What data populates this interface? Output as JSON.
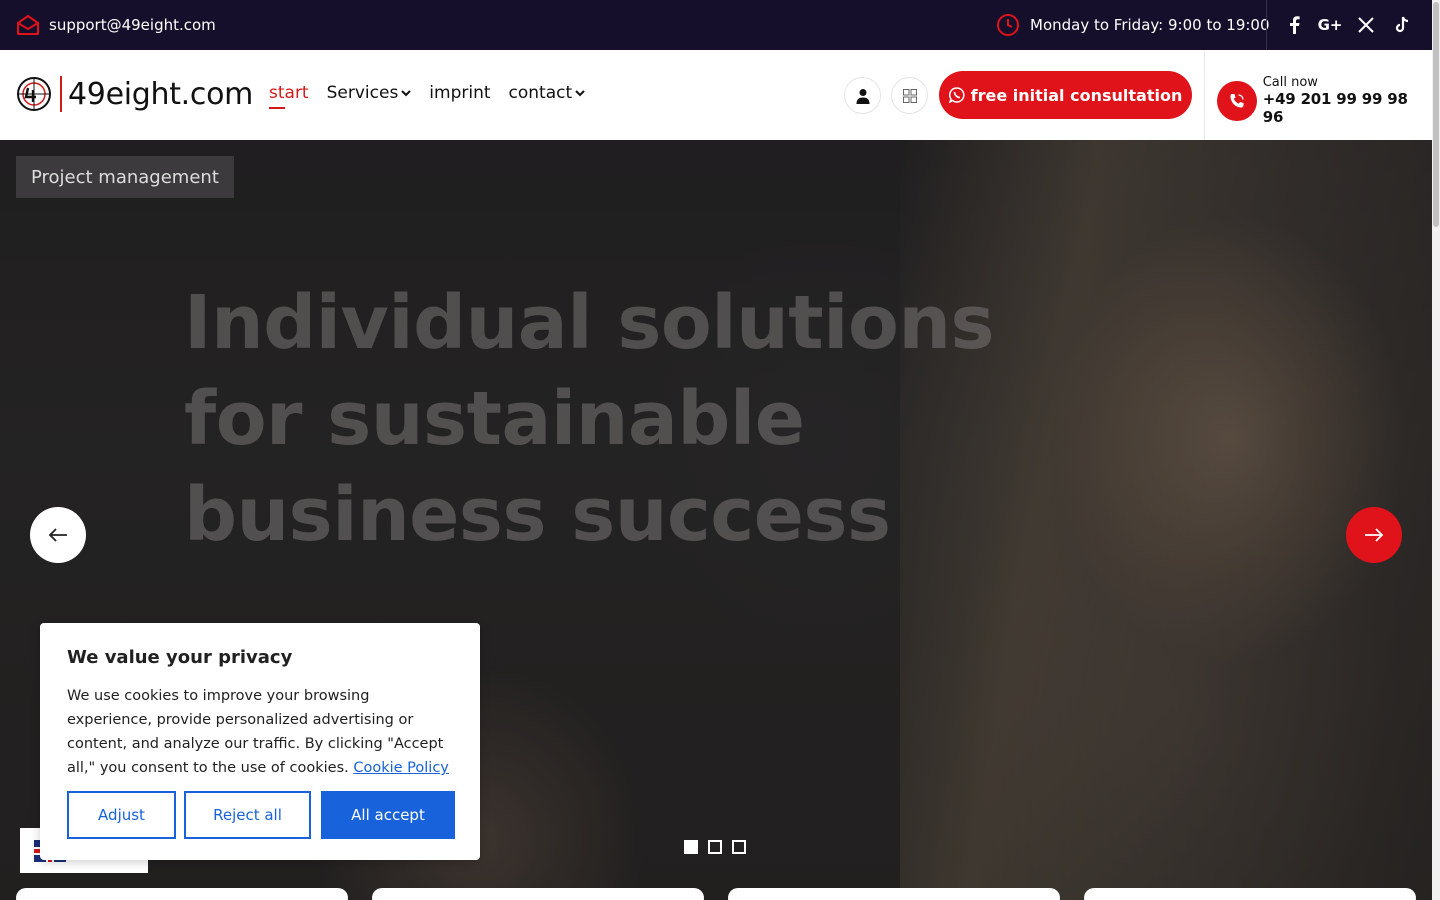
{
  "topbar": {
    "email": "support@49eight.com",
    "hours": "Monday to Friday: 9:00 to 19:00",
    "socials": [
      "facebook-icon",
      "google-plus-icon",
      "x-icon",
      "tiktok-icon"
    ],
    "google_label": "G+"
  },
  "header": {
    "logo_text": "49eight.com",
    "nav": [
      {
        "label": "start",
        "active": true
      },
      {
        "label": "Services",
        "dropdown": true
      },
      {
        "label": "imprint"
      },
      {
        "label": "contact",
        "dropdown": true
      }
    ],
    "cta_label": "free initial consultation",
    "call_label": "Call now",
    "call_number": "+49 201 99 99 98 96"
  },
  "hero": {
    "tag": "Project management",
    "title": "Individual solutions for sustainable business success",
    "slides_total": 3,
    "active_slide": 1
  },
  "cookie": {
    "title": "We value your privacy",
    "text": "We use cookies to improve your browsing experience, provide personalized advertising or content, and analyze our traffic. By clicking \"Accept all,\" you consent to the use of cookies.",
    "policy_link": "Cookie Policy",
    "buttons": {
      "adjust": "Adjust",
      "reject": "Reject all",
      "accept": "All accept"
    }
  },
  "colors": {
    "brand_red": "#e0121a",
    "topbar_bg": "#160f2b",
    "cookie_blue": "#1863dc"
  }
}
